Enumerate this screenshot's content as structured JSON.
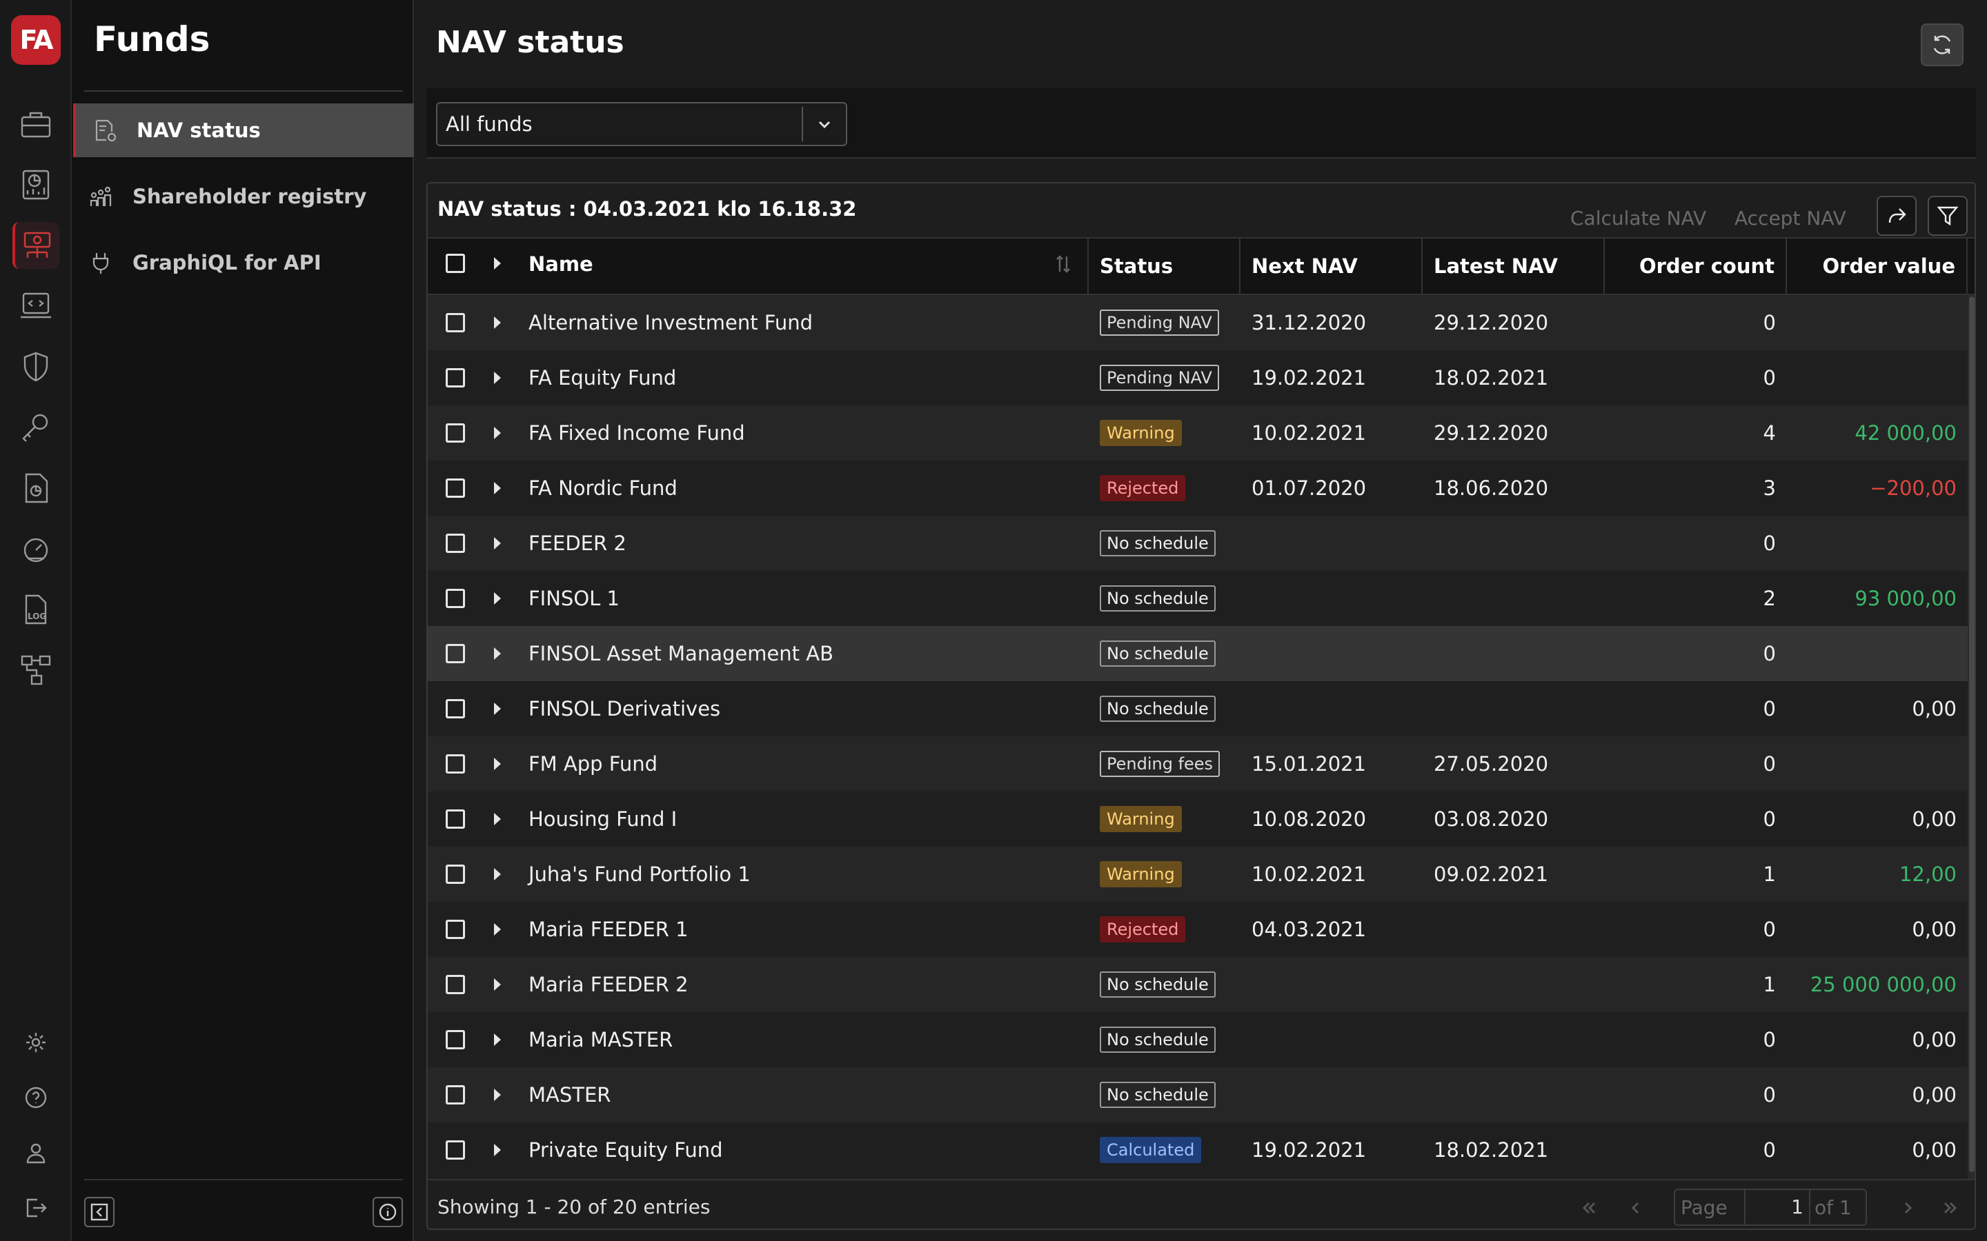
{
  "app": {
    "logo_text": "FA",
    "accent": "#c2222a"
  },
  "nav": {
    "title": "Funds",
    "items": [
      {
        "label": "NAV status",
        "icon": "document-gear-icon"
      },
      {
        "label": "Shareholder registry",
        "icon": "people-chart-icon"
      },
      {
        "label": "GraphiQL for API",
        "icon": "plug-icon"
      }
    ]
  },
  "main": {
    "title": "NAV status",
    "filter": {
      "selected": "All funds"
    }
  },
  "grid": {
    "title": "NAV status : 04.03.2021 klo 16.18.32",
    "calculate_label": "Calculate NAV",
    "accept_label": "Accept NAV",
    "columns": {
      "name": "Name",
      "status": "Status",
      "next_nav": "Next NAV",
      "latest_nav": "Latest NAV",
      "order_count": "Order count",
      "order_value": "Order value"
    },
    "rows": [
      {
        "name": "Alternative Investment Fund",
        "status": "Pending NAV",
        "kind": "pending",
        "next": "31.12.2020",
        "latest": "29.12.2020",
        "count": "0",
        "value": ""
      },
      {
        "name": "FA Equity Fund",
        "status": "Pending NAV",
        "kind": "pending",
        "next": "19.02.2021",
        "latest": "18.02.2021",
        "count": "0",
        "value": ""
      },
      {
        "name": "FA Fixed Income Fund",
        "status": "Warning",
        "kind": "warning",
        "next": "10.02.2021",
        "latest": "29.12.2020",
        "count": "4",
        "value": "42 000,00",
        "vkind": "pos"
      },
      {
        "name": "FA Nordic Fund",
        "status": "Rejected",
        "kind": "rejected",
        "next": "01.07.2020",
        "latest": "18.06.2020",
        "count": "3",
        "value": "−200,00",
        "vkind": "neg"
      },
      {
        "name": "FEEDER 2",
        "status": "No schedule",
        "kind": "none",
        "next": "",
        "latest": "",
        "count": "0",
        "value": ""
      },
      {
        "name": "FINSOL 1",
        "status": "No schedule",
        "kind": "none",
        "next": "",
        "latest": "",
        "count": "2",
        "value": "93 000,00",
        "vkind": "pos"
      },
      {
        "name": "FINSOL Asset Management AB",
        "status": "No schedule",
        "kind": "none",
        "next": "",
        "latest": "",
        "count": "0",
        "value": "",
        "hl": true
      },
      {
        "name": "FINSOL Derivatives",
        "status": "No schedule",
        "kind": "none",
        "next": "",
        "latest": "",
        "count": "0",
        "value": "0,00"
      },
      {
        "name": "FM App Fund",
        "status": "Pending fees",
        "kind": "pending",
        "next": "15.01.2021",
        "latest": "27.05.2020",
        "count": "0",
        "value": ""
      },
      {
        "name": "Housing Fund I",
        "status": "Warning",
        "kind": "warning",
        "next": "10.08.2020",
        "latest": "03.08.2020",
        "count": "0",
        "value": "0,00"
      },
      {
        "name": "Juha's Fund Portfolio 1",
        "status": "Warning",
        "kind": "warning",
        "next": "10.02.2021",
        "latest": "09.02.2021",
        "count": "1",
        "value": "12,00",
        "vkind": "pos"
      },
      {
        "name": "Maria FEEDER 1",
        "status": "Rejected",
        "kind": "rejected",
        "next": "04.03.2021",
        "latest": "",
        "count": "0",
        "value": "0,00"
      },
      {
        "name": "Maria FEEDER 2",
        "status": "No schedule",
        "kind": "none",
        "next": "",
        "latest": "",
        "count": "1",
        "value": "25 000 000,00",
        "vkind": "pos"
      },
      {
        "name": "Maria MASTER",
        "status": "No schedule",
        "kind": "none",
        "next": "",
        "latest": "",
        "count": "0",
        "value": "0,00"
      },
      {
        "name": "MASTER",
        "status": "No schedule",
        "kind": "none",
        "next": "",
        "latest": "",
        "count": "0",
        "value": "0,00"
      },
      {
        "name": "Private Equity Fund",
        "status": "Calculated",
        "kind": "calc",
        "next": "19.02.2021",
        "latest": "18.02.2021",
        "count": "0",
        "value": "0,00"
      }
    ],
    "footer": {
      "showing": "Showing 1 - 20 of 20 entries",
      "page_label": "Page",
      "page_value": "1",
      "page_of": "of 1"
    }
  }
}
